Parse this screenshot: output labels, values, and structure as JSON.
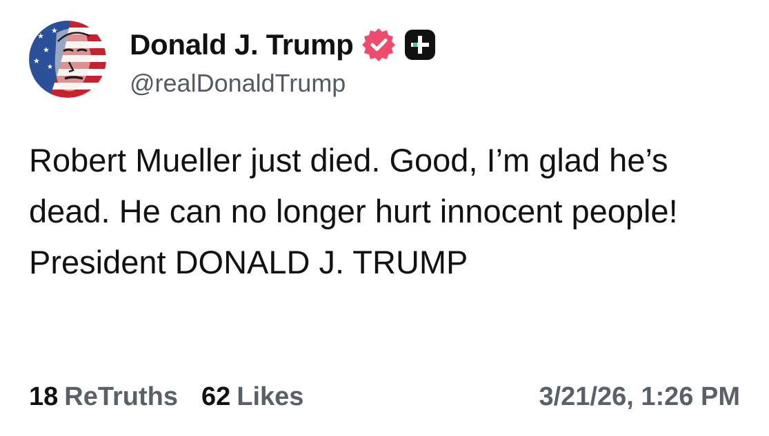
{
  "post": {
    "author": {
      "display_name": "Donald J. Trump",
      "handle": "@realDonaldTrump",
      "verified_icon": "verified-badge-icon",
      "extra_badge_icon": "plus-badge-icon",
      "verified_color": "#ef4b6c",
      "extra_badge_color": "#111111",
      "extra_badge_accent": "#47c6b0"
    },
    "text": "Robert Mueller just died. Good, I’m glad he’s dead. He can no longer hurt innocent people! President DONALD J. TRUMP",
    "stats": {
      "retruths_count": "18",
      "retruths_label": "ReTruths",
      "likes_count": "62",
      "likes_label": "Likes"
    },
    "timestamp": "3/21/26, 1:26 PM"
  }
}
